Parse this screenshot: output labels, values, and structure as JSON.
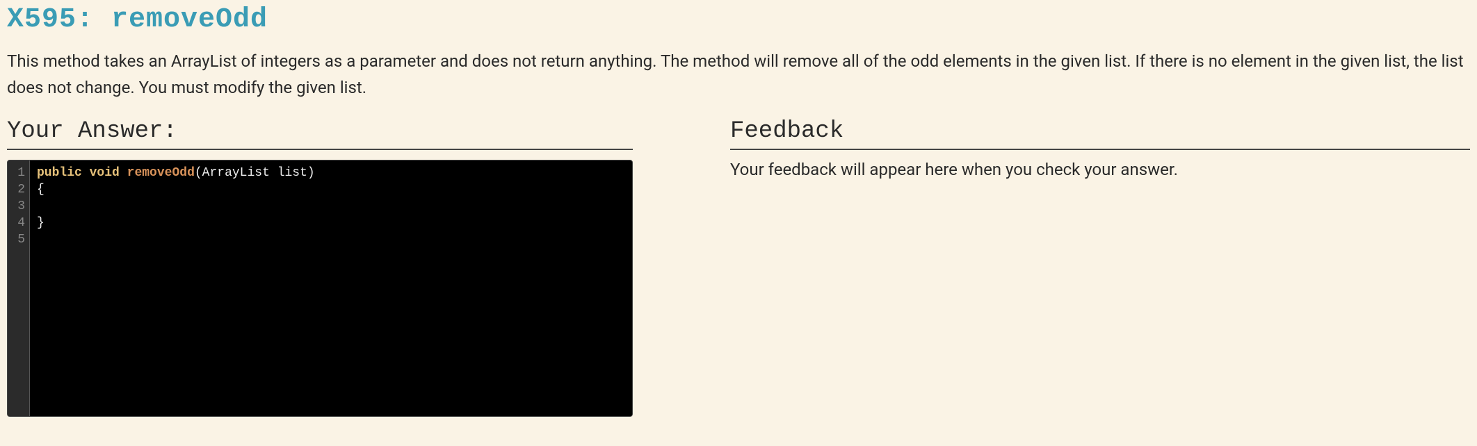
{
  "problem": {
    "title": "X595: removeOdd",
    "description": "This method takes an ArrayList of integers as a parameter and does not return anything. The method will remove all of the odd elements in the given list. If there is no element in the given list, the list does not change. You must modify the given list."
  },
  "answer": {
    "heading": "Your Answer:",
    "code_lines": [
      {
        "n": "1",
        "tokens": [
          {
            "cls": "kw",
            "t": "public"
          },
          {
            "cls": "plain",
            "t": " "
          },
          {
            "cls": "kw",
            "t": "void"
          },
          {
            "cls": "plain",
            "t": " "
          },
          {
            "cls": "fn",
            "t": "removeOdd"
          },
          {
            "cls": "plain",
            "t": "(ArrayList list)"
          }
        ]
      },
      {
        "n": "2",
        "tokens": [
          {
            "cls": "plain",
            "t": "{"
          }
        ]
      },
      {
        "n": "3",
        "tokens": []
      },
      {
        "n": "4",
        "tokens": [
          {
            "cls": "plain",
            "t": "}"
          }
        ]
      },
      {
        "n": "5",
        "tokens": []
      }
    ]
  },
  "feedback": {
    "heading": "Feedback",
    "text": "Your feedback will appear here when you check your answer."
  }
}
